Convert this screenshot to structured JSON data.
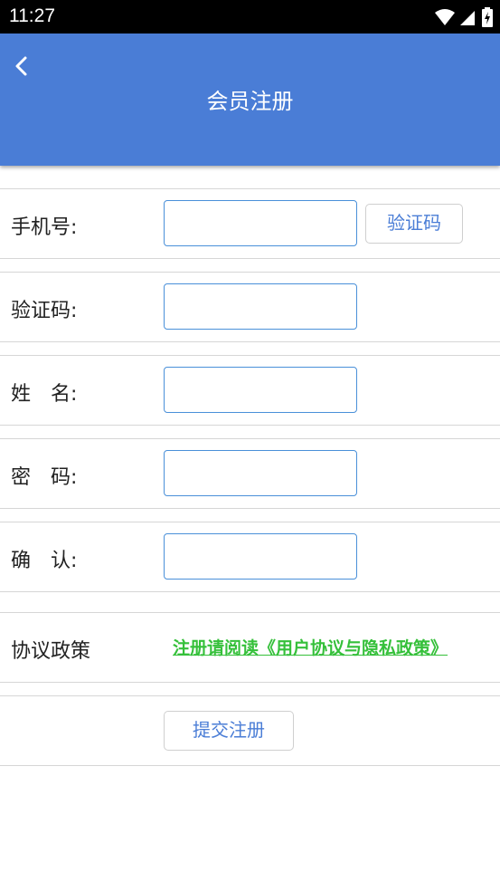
{
  "status_bar": {
    "time": "11:27"
  },
  "header": {
    "title": "会员注册"
  },
  "form": {
    "phone": {
      "label": "手机号:",
      "value": "",
      "code_button": "验证码"
    },
    "code": {
      "label": "验证码:",
      "value": ""
    },
    "name": {
      "label": "姓　名:",
      "value": ""
    },
    "password": {
      "label": "密　码:",
      "value": ""
    },
    "confirm": {
      "label": "确　认:",
      "value": ""
    },
    "policy": {
      "label": "协议政策",
      "link": "注册请阅读《用户协议与隐私政策》"
    },
    "submit_label": "提交注册"
  },
  "colors": {
    "header": "#4a7dd6",
    "link": "#35c03a",
    "input_border": "#4a90d9"
  }
}
